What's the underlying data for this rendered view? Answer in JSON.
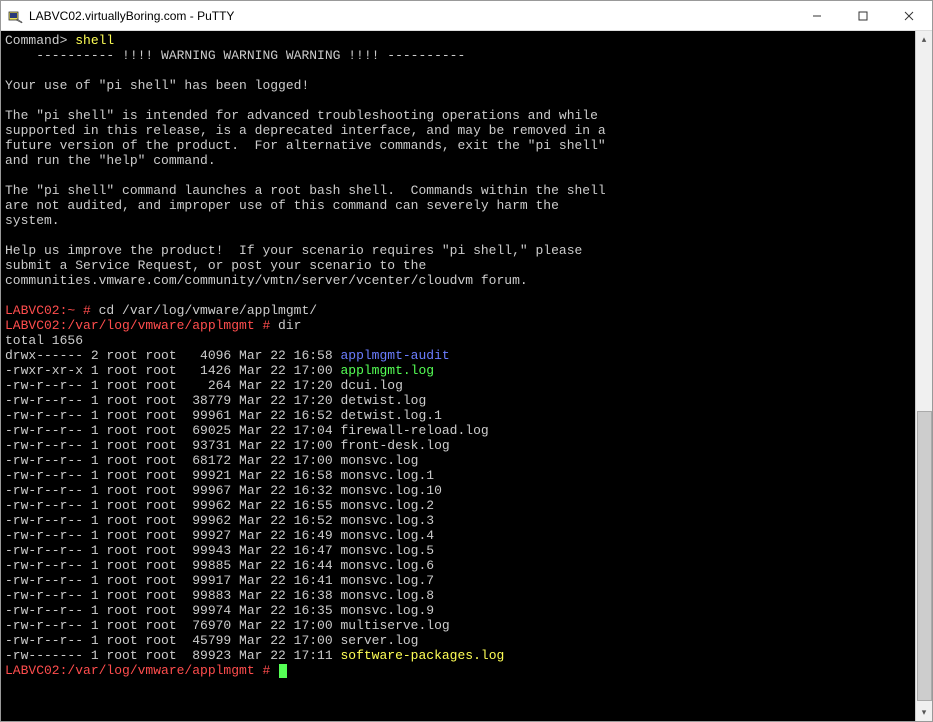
{
  "window": {
    "title": "LABVC02.virtuallyBoring.com - PuTTY"
  },
  "prompt1": {
    "label": "Command> ",
    "cmd": "shell"
  },
  "warning_lines": [
    "    ---------- !!!! WARNING WARNING WARNING !!!! ----------",
    "",
    "Your use of \"pi shell\" has been logged!",
    "",
    "The \"pi shell\" is intended for advanced troubleshooting operations and while",
    "supported in this release, is a deprecated interface, and may be removed in a",
    "future version of the product.  For alternative commands, exit the \"pi shell\"",
    "and run the \"help\" command.",
    "",
    "The \"pi shell\" command launches a root bash shell.  Commands within the shell",
    "are not audited, and improper use of this command can severely harm the",
    "system.",
    "",
    "Help us improve the product!  If your scenario requires \"pi shell,\" please",
    "submit a Service Request, or post your scenario to the",
    "communities.vmware.com/community/vmtn/server/vcenter/cloudvm forum.",
    ""
  ],
  "prompt2": {
    "host": "LABVC02",
    "cwd": "~",
    "sep": " # ",
    "cmd": "cd /var/log/vmware/applmgmt/"
  },
  "prompt3": {
    "host": "LABVC02",
    "cwd": "/var/log/vmware/applmgmt",
    "sep": " # ",
    "cmd": "dir"
  },
  "total_line": "total 1656",
  "listing": [
    {
      "perm": "drwx------",
      "n": "2",
      "u": "root",
      "g": "root",
      "sz": "  4096",
      "dt": "Mar 22 16:58",
      "name": "applmgmt-audit",
      "cls": "blue"
    },
    {
      "perm": "-rwxr-xr-x",
      "n": "1",
      "u": "root",
      "g": "root",
      "sz": "  1426",
      "dt": "Mar 22 17:00",
      "name": "applmgmt.log",
      "cls": "green"
    },
    {
      "perm": "-rw-r--r--",
      "n": "1",
      "u": "root",
      "g": "root",
      "sz": "   264",
      "dt": "Mar 22 17:20",
      "name": "dcui.log",
      "cls": ""
    },
    {
      "perm": "-rw-r--r--",
      "n": "1",
      "u": "root",
      "g": "root",
      "sz": " 38779",
      "dt": "Mar 22 17:20",
      "name": "detwist.log",
      "cls": ""
    },
    {
      "perm": "-rw-r--r--",
      "n": "1",
      "u": "root",
      "g": "root",
      "sz": " 99961",
      "dt": "Mar 22 16:52",
      "name": "detwist.log.1",
      "cls": ""
    },
    {
      "perm": "-rw-r--r--",
      "n": "1",
      "u": "root",
      "g": "root",
      "sz": " 69025",
      "dt": "Mar 22 17:04",
      "name": "firewall-reload.log",
      "cls": ""
    },
    {
      "perm": "-rw-r--r--",
      "n": "1",
      "u": "root",
      "g": "root",
      "sz": " 93731",
      "dt": "Mar 22 17:00",
      "name": "front-desk.log",
      "cls": ""
    },
    {
      "perm": "-rw-r--r--",
      "n": "1",
      "u": "root",
      "g": "root",
      "sz": " 68172",
      "dt": "Mar 22 17:00",
      "name": "monsvc.log",
      "cls": ""
    },
    {
      "perm": "-rw-r--r--",
      "n": "1",
      "u": "root",
      "g": "root",
      "sz": " 99921",
      "dt": "Mar 22 16:58",
      "name": "monsvc.log.1",
      "cls": ""
    },
    {
      "perm": "-rw-r--r--",
      "n": "1",
      "u": "root",
      "g": "root",
      "sz": " 99967",
      "dt": "Mar 22 16:32",
      "name": "monsvc.log.10",
      "cls": ""
    },
    {
      "perm": "-rw-r--r--",
      "n": "1",
      "u": "root",
      "g": "root",
      "sz": " 99962",
      "dt": "Mar 22 16:55",
      "name": "monsvc.log.2",
      "cls": ""
    },
    {
      "perm": "-rw-r--r--",
      "n": "1",
      "u": "root",
      "g": "root",
      "sz": " 99962",
      "dt": "Mar 22 16:52",
      "name": "monsvc.log.3",
      "cls": ""
    },
    {
      "perm": "-rw-r--r--",
      "n": "1",
      "u": "root",
      "g": "root",
      "sz": " 99927",
      "dt": "Mar 22 16:49",
      "name": "monsvc.log.4",
      "cls": ""
    },
    {
      "perm": "-rw-r--r--",
      "n": "1",
      "u": "root",
      "g": "root",
      "sz": " 99943",
      "dt": "Mar 22 16:47",
      "name": "monsvc.log.5",
      "cls": ""
    },
    {
      "perm": "-rw-r--r--",
      "n": "1",
      "u": "root",
      "g": "root",
      "sz": " 99885",
      "dt": "Mar 22 16:44",
      "name": "monsvc.log.6",
      "cls": ""
    },
    {
      "perm": "-rw-r--r--",
      "n": "1",
      "u": "root",
      "g": "root",
      "sz": " 99917",
      "dt": "Mar 22 16:41",
      "name": "monsvc.log.7",
      "cls": ""
    },
    {
      "perm": "-rw-r--r--",
      "n": "1",
      "u": "root",
      "g": "root",
      "sz": " 99883",
      "dt": "Mar 22 16:38",
      "name": "monsvc.log.8",
      "cls": ""
    },
    {
      "perm": "-rw-r--r--",
      "n": "1",
      "u": "root",
      "g": "root",
      "sz": " 99974",
      "dt": "Mar 22 16:35",
      "name": "monsvc.log.9",
      "cls": ""
    },
    {
      "perm": "-rw-r--r--",
      "n": "1",
      "u": "root",
      "g": "root",
      "sz": " 76970",
      "dt": "Mar 22 17:00",
      "name": "multiserve.log",
      "cls": ""
    },
    {
      "perm": "-rw-r--r--",
      "n": "1",
      "u": "root",
      "g": "root",
      "sz": " 45799",
      "dt": "Mar 22 17:00",
      "name": "server.log",
      "cls": ""
    },
    {
      "perm": "-rw-------",
      "n": "1",
      "u": "root",
      "g": "root",
      "sz": " 89923",
      "dt": "Mar 22 17:11",
      "name": "software-packages.log",
      "cls": "yellow"
    }
  ],
  "prompt4": {
    "host": "LABVC02",
    "cwd": "/var/log/vmware/applmgmt",
    "sep": " # "
  }
}
